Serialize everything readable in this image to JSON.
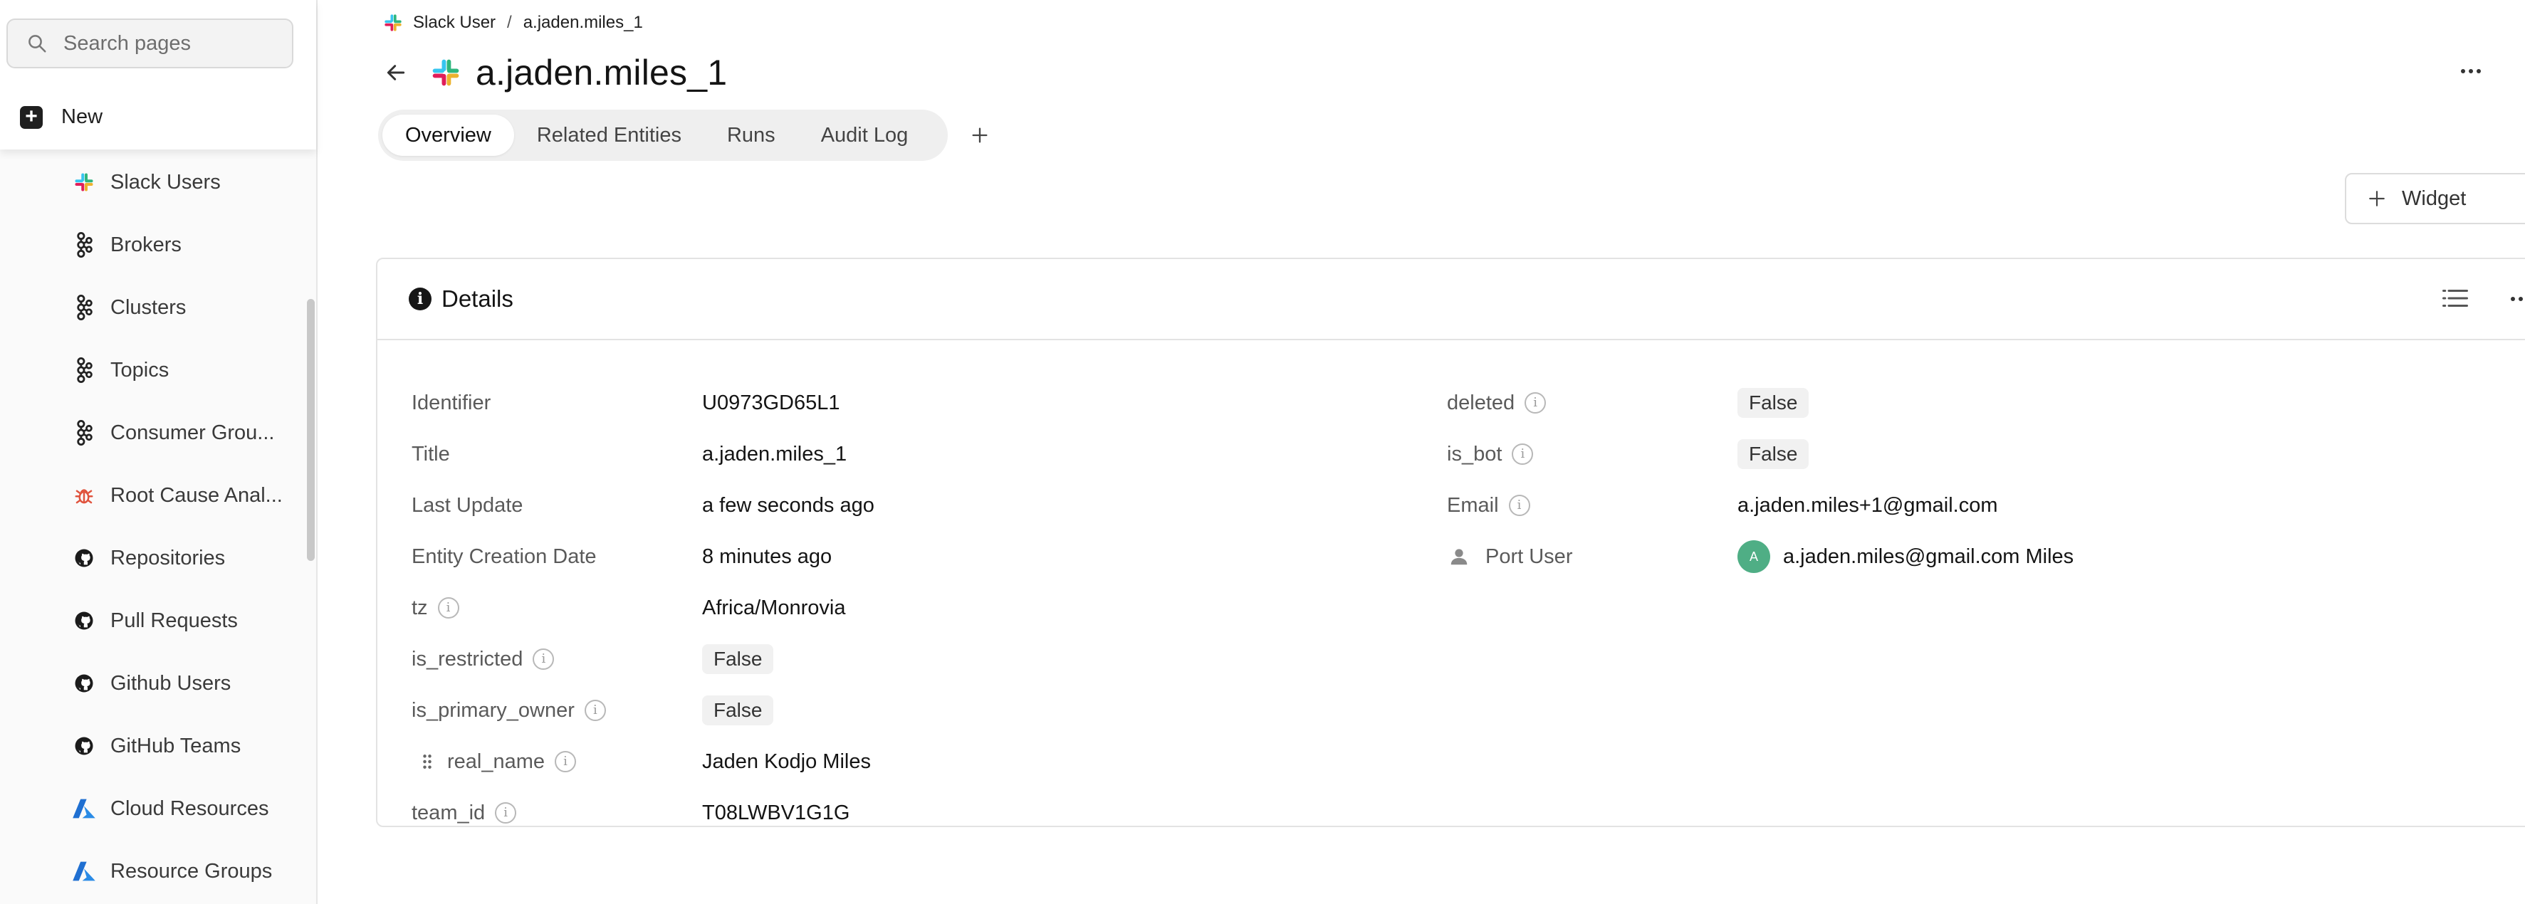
{
  "sidebar": {
    "search_placeholder": "Search pages",
    "new_label": "New",
    "items": [
      {
        "label": "Slack Users",
        "icon": "slack-icon"
      },
      {
        "label": "Brokers",
        "icon": "kafka-icon"
      },
      {
        "label": "Clusters",
        "icon": "kafka-icon"
      },
      {
        "label": "Topics",
        "icon": "kafka-icon"
      },
      {
        "label": "Consumer Grou...",
        "icon": "kafka-icon"
      },
      {
        "label": "Root Cause Anal...",
        "icon": "bug-icon"
      },
      {
        "label": "Repositories",
        "icon": "github-icon"
      },
      {
        "label": "Pull Requests",
        "icon": "github-icon"
      },
      {
        "label": "Github Users",
        "icon": "github-icon"
      },
      {
        "label": "GitHub Teams",
        "icon": "github-icon"
      },
      {
        "label": "Cloud Resources",
        "icon": "azure-icon"
      },
      {
        "label": "Resource Groups",
        "icon": "azure-icon"
      }
    ]
  },
  "breadcrumb": {
    "parent": "Slack User",
    "separator": "/",
    "current": "a.jaden.miles_1"
  },
  "header": {
    "title": "a.jaden.miles_1"
  },
  "tabs": [
    {
      "label": "Overview",
      "active": true
    },
    {
      "label": "Related Entities",
      "active": false
    },
    {
      "label": "Runs",
      "active": false
    },
    {
      "label": "Audit Log",
      "active": false
    }
  ],
  "widget_button_label": "Widget",
  "details": {
    "title": "Details",
    "left": [
      {
        "key": "Identifier",
        "value": "U0973GD65L1"
      },
      {
        "key": "Title",
        "value": "a.jaden.miles_1"
      },
      {
        "key": "Last Update",
        "value": "a few seconds ago"
      },
      {
        "key": "Entity Creation Date",
        "value": "8 minutes ago"
      },
      {
        "key": "tz",
        "value": "Africa/Monrovia"
      },
      {
        "key": "is_restricted",
        "value": "False"
      },
      {
        "key": "is_primary_owner",
        "value": "False"
      },
      {
        "key": "real_name",
        "value": "Jaden Kodjo Miles"
      },
      {
        "key": "team_id",
        "value": "T08LWBV1G1G"
      }
    ],
    "right": [
      {
        "key": "deleted",
        "value": "False"
      },
      {
        "key": "is_bot",
        "value": "False"
      },
      {
        "key": "Email",
        "value": "a.jaden.miles+1@gmail.com"
      },
      {
        "key": "Port User",
        "value": "a.jaden.miles@gmail.com Miles",
        "avatar_letter": "A"
      }
    ]
  },
  "colors": {
    "avatar": "#4fae85",
    "pill_bg": "#f1f1f1"
  }
}
